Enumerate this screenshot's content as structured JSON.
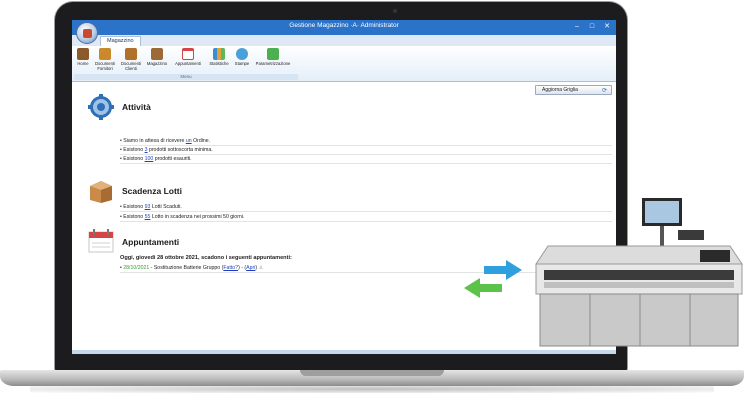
{
  "window": {
    "title": "Gestione Magazzino ·A· Administrator",
    "controls": [
      "–",
      "□",
      "✕"
    ]
  },
  "ribbon": {
    "tab": "Magazzino",
    "group_label": "Menu",
    "buttons": [
      {
        "label": "Home",
        "icon": "home-icon",
        "color": "#8a5a2b"
      },
      {
        "label": "Documenti Fornitori",
        "icon": "supplier-docs-icon",
        "color": "#c98a2c"
      },
      {
        "label": "Documenti Clienti",
        "icon": "client-docs-icon",
        "color": "#b0702a"
      },
      {
        "label": "Magazzino",
        "icon": "warehouse-icon",
        "color": "#9c6a36"
      },
      {
        "label": "Appuntamenti",
        "icon": "calendar-icon",
        "color": "#d64545"
      },
      {
        "label": "Statistiche",
        "icon": "statistics-icon",
        "color": "#3a8ed1"
      },
      {
        "label": "Stampe",
        "icon": "print-icon",
        "color": "#4aa0d8"
      },
      {
        "label": "Parametrizzazione",
        "icon": "settings-icon",
        "color": "#4caf50"
      }
    ]
  },
  "content": {
    "refresh_button": "Aggiorna Griglia",
    "attivita": {
      "title": "Attività",
      "lines": [
        {
          "pre": "Siamo in attesa di ricevere ",
          "link": "un",
          "post": " Ordine."
        },
        {
          "pre": "Esistono ",
          "link": "3",
          "post": " prodotti sottoscorta minima."
        },
        {
          "pre": "Esistono ",
          "link": "100",
          "post": " prodotti esauriti."
        }
      ]
    },
    "lotti": {
      "title": "Scadenza Lotti",
      "lines": [
        {
          "pre": "Esistono ",
          "link": "93",
          "post": " Lotti Scaduti."
        },
        {
          "pre": "Esistono ",
          "link": "55",
          "post": " Lotto in scadenza nei prossimi 50 giorni."
        }
      ]
    },
    "appuntamenti": {
      "title": "Appuntamenti",
      "heading": "Oggi, giovedì 28 ottobre 2021, scadono i seguenti appuntamenti:",
      "item": {
        "date": "28/10/2021",
        "text": " - Sostituzione Batterie Gruppo ",
        "done_link": "Fatto?",
        "sep": " - ",
        "open_link": "Apri"
      }
    }
  },
  "colors": {
    "titlebar": "#2b73c9",
    "arrow_green": "#5cc34a",
    "arrow_blue": "#2ea0dd",
    "link": "#1f3fbf"
  }
}
